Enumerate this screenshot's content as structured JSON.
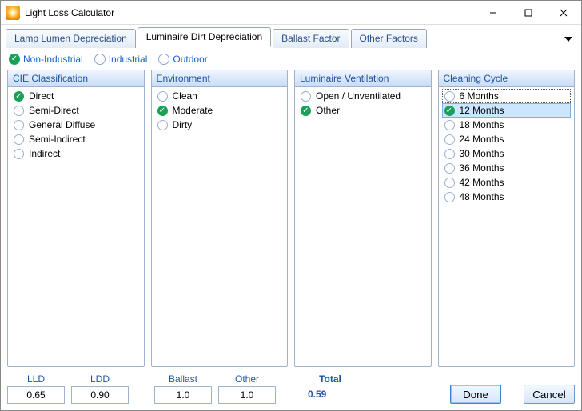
{
  "title": "Light Loss Calculator",
  "tabs": [
    "Lamp Lumen Depreciation",
    "Luminaire Dirt Depreciation",
    "Ballast Factor",
    "Other Factors"
  ],
  "active_tab_index": 1,
  "modes": {
    "items": [
      "Non-Industrial",
      "Industrial",
      "Outdoor"
    ],
    "selected_index": 0
  },
  "panels": {
    "cie": {
      "title": "CIE Classification",
      "options": [
        "Direct",
        "Semi-Direct",
        "General Diffuse",
        "Semi-Indirect",
        "Indirect"
      ],
      "selected_index": 0
    },
    "env": {
      "title": "Environment",
      "options": [
        "Clean",
        "Moderate",
        "Dirty"
      ],
      "selected_index": 1
    },
    "vent": {
      "title": "Luminaire Ventilation",
      "options": [
        "Open / Unventilated",
        "Other"
      ],
      "selected_index": 1
    },
    "clean": {
      "title": "Cleaning Cycle",
      "options": [
        "6 Months",
        "12 Months",
        "18 Months",
        "24 Months",
        "30 Months",
        "36 Months",
        "42 Months",
        "48 Months"
      ],
      "selected_index": 1,
      "focus_index": 0
    }
  },
  "footer": {
    "lld_label": "LLD",
    "ldd_label": "LDD",
    "ballast_label": "Ballast",
    "other_label": "Other",
    "total_label": "Total",
    "lld": "0.65",
    "ldd": "0.90",
    "ballast": "1.0",
    "other": "1.0",
    "total": "0.59",
    "done": "Done",
    "cancel": "Cancel"
  }
}
